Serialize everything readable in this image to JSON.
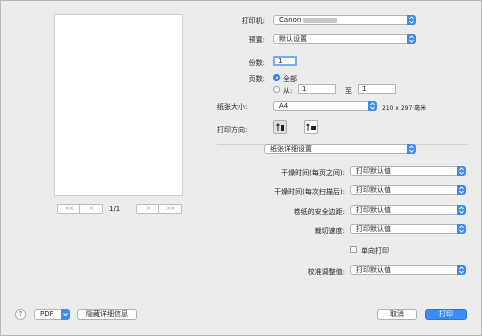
{
  "preview": {
    "page_indicator": "1/1",
    "first_icon": "<<",
    "prev_icon": "<",
    "next_icon": ">",
    "last_icon": ">>"
  },
  "printer": {
    "label": "打印机:",
    "value": "Canon"
  },
  "preset": {
    "label": "预置:",
    "value": "默认设置"
  },
  "copies": {
    "label": "份数:",
    "value": "1"
  },
  "pages": {
    "label": "页数:",
    "all_label": "全部",
    "from_label": "从:",
    "from_value": "1",
    "to_label": "至",
    "to_value": "1"
  },
  "paper_size": {
    "label": "纸张大小:",
    "value": "A4",
    "dimensions": "210 x 297 毫米"
  },
  "orientation": {
    "label": "打印方向:"
  },
  "section_popup": {
    "value": "纸张详细设置"
  },
  "details": [
    {
      "label": "干燥时间(每页之间):",
      "value": "打印默认值"
    },
    {
      "label": "干燥时间(每次扫描后):",
      "value": "打印默认值"
    },
    {
      "label": "卷纸的安全边距:",
      "value": "打印默认值"
    },
    {
      "label": "裁切速度:",
      "value": "打印默认值"
    }
  ],
  "unidirectional": {
    "label": "单向打印",
    "checked": false
  },
  "calibration": {
    "label": "校准调整值:",
    "value": "打印默认值"
  },
  "footer": {
    "help": "?",
    "pdf": "PDF",
    "hide_details": "隐藏详细信息",
    "cancel": "取消",
    "print": "打印"
  },
  "colors": {
    "accent": "#3b8cf5",
    "background": "#ececec"
  }
}
